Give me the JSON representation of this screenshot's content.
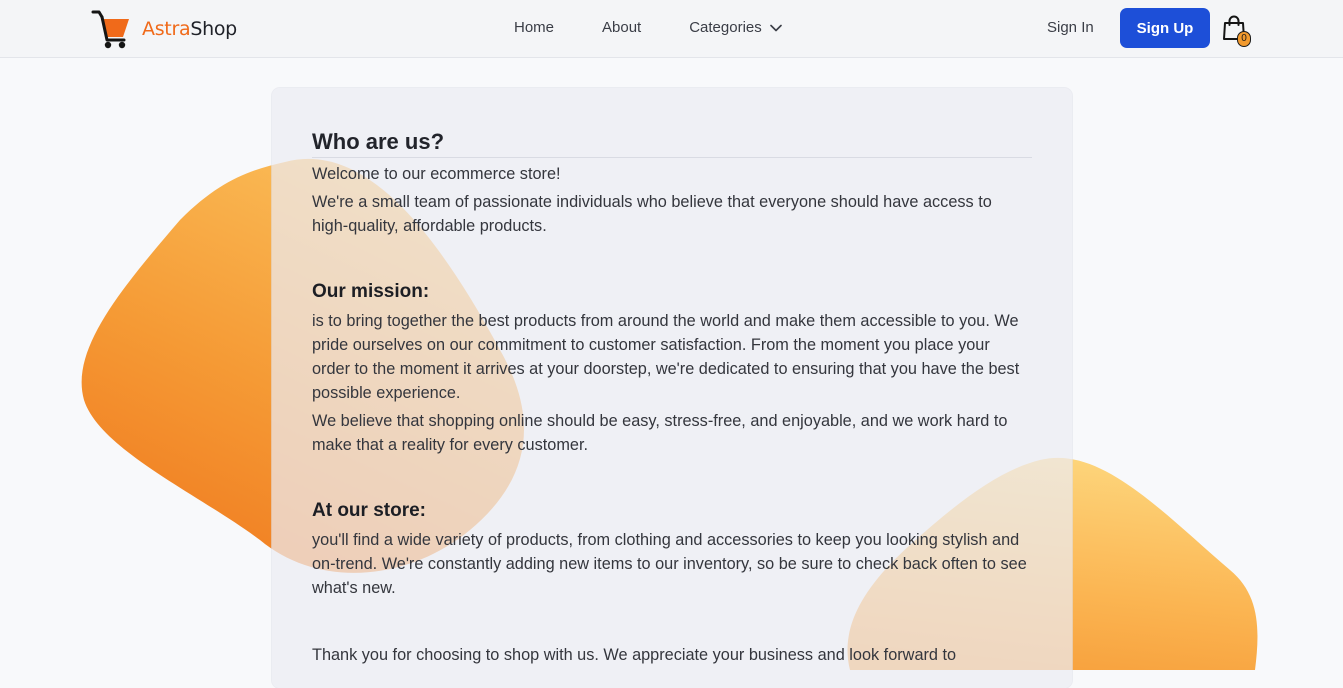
{
  "brand": {
    "name_part1": "Astra",
    "name_part2": "Shop",
    "logo_icon": "shopping-cart-icon",
    "accent_color": "#f06a1a"
  },
  "nav": {
    "home": "Home",
    "about": "About",
    "categories": "Categories",
    "categories_icon": "chevron-down-icon"
  },
  "auth": {
    "sign_in": "Sign In",
    "sign_up": "Sign Up",
    "sign_up_color": "#1d4fd8"
  },
  "cart": {
    "icon": "shopping-bag-icon",
    "count": "0"
  },
  "about": {
    "title": "Who are us?",
    "welcome": "Welcome to our ecommerce store!",
    "intro": "We're a small team of passionate individuals who believe that everyone should have access to high-quality, affordable products.",
    "mission_heading": "Our mission:",
    "mission_text": "is to bring together the best products from around the world and make them accessible to you. We pride ourselves on our commitment to customer satisfaction. From the moment you place your order to the moment it arrives at your doorstep, we're dedicated to ensuring that you have the best possible experience.",
    "mission_text2": "We believe that shopping online should be easy, stress-free, and enjoyable, and we work hard to make that a reality for every customer.",
    "store_heading": "At our store:",
    "store_text": "you'll find a wide variety of products, from clothing and accessories to keep you looking stylish and on-trend. We're constantly adding new items to our inventory, so be sure to check back often to see what's new.",
    "thanks_text": "Thank you for choosing to shop with us. We appreciate your business and look forward to"
  }
}
